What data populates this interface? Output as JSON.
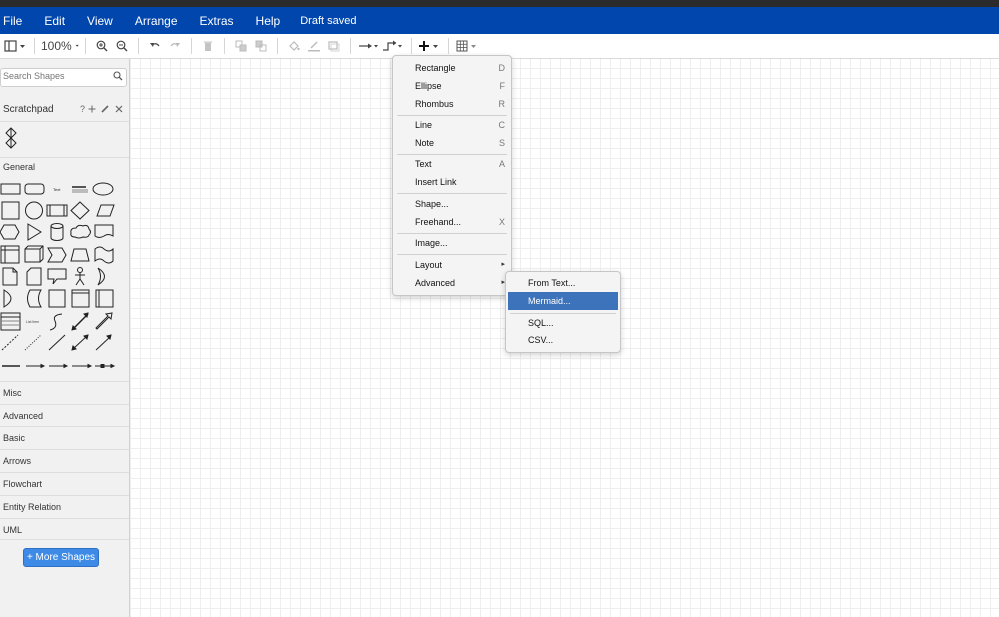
{
  "menubar": {
    "items": [
      "File",
      "Edit",
      "View",
      "Arrange",
      "Extras",
      "Help"
    ],
    "status": "Draft saved"
  },
  "toolbar": {
    "zoom": "100%"
  },
  "sidebar": {
    "search_placeholder": "Search Shapes",
    "scratchpad_title": "Scratchpad",
    "scratchpad_help": "?",
    "general_title": "General",
    "sections": [
      "Misc",
      "Advanced",
      "Basic",
      "Arrows",
      "Flowchart",
      "Entity Relation",
      "UML"
    ],
    "more_shapes": "+ More Shapes"
  },
  "insert_menu": {
    "groups": [
      [
        {
          "label": "Rectangle",
          "shortcut": "D"
        },
        {
          "label": "Ellipse",
          "shortcut": "F"
        },
        {
          "label": "Rhombus",
          "shortcut": "R"
        }
      ],
      [
        {
          "label": "Line",
          "shortcut": "C"
        },
        {
          "label": "Note",
          "shortcut": "S"
        }
      ],
      [
        {
          "label": "Text",
          "shortcut": "A"
        },
        {
          "label": "Insert Link",
          "shortcut": ""
        }
      ],
      [
        {
          "label": "Shape...",
          "shortcut": ""
        },
        {
          "label": "Freehand...",
          "shortcut": "X"
        }
      ],
      [
        {
          "label": "Image...",
          "shortcut": ""
        }
      ],
      [
        {
          "label": "Layout",
          "shortcut": "▸"
        },
        {
          "label": "Advanced",
          "shortcut": "▸"
        }
      ]
    ]
  },
  "advanced_submenu": {
    "items": [
      "From Text...",
      "Mermaid...",
      "SQL...",
      "CSV..."
    ],
    "highlighted": "Mermaid..."
  },
  "colors": {
    "menubar": "#0046ad",
    "highlight": "#3d73ba",
    "more_shapes": "#3d8be6"
  }
}
